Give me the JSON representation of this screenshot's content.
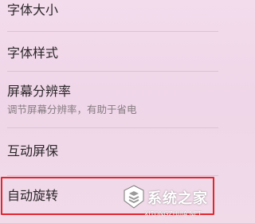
{
  "settings": {
    "items": [
      {
        "label": "字体大小"
      },
      {
        "label": "字体样式"
      },
      {
        "label": "屏幕分辨率",
        "subtitle": "调节屏幕分辨率，有助于省电"
      },
      {
        "label": "互动屏保"
      },
      {
        "label": "自动旋转"
      }
    ]
  },
  "watermark": {
    "name": "系统之家",
    "url": "XITONGZHIJIA.NET"
  },
  "colors": {
    "background": "#f0d8ea",
    "highlight_border": "#e3262e",
    "subtitle": "#857b81"
  }
}
